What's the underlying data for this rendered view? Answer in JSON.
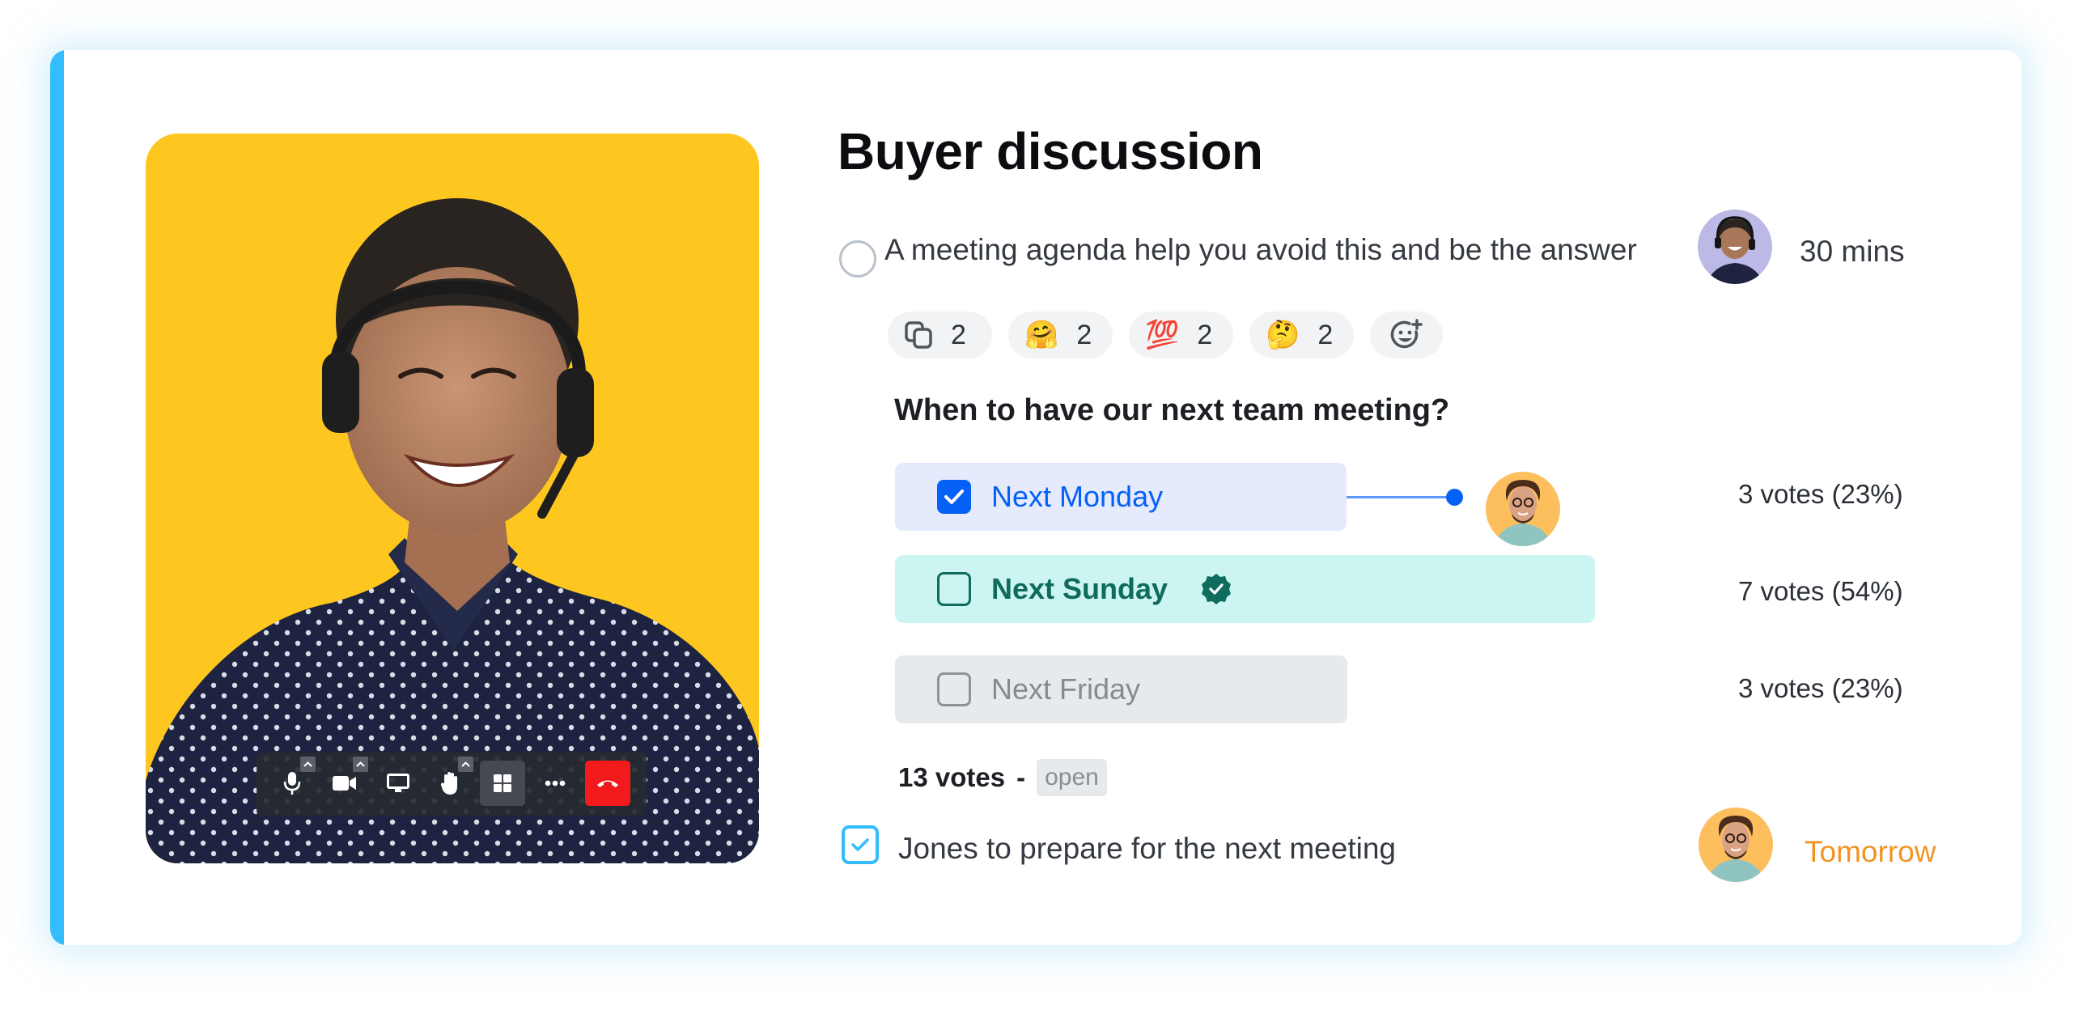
{
  "card": {
    "accent_color": "#34BDFD"
  },
  "video_call": {
    "background_color": "#FEC720",
    "toolbar": [
      {
        "name": "microphone",
        "icon": "mic-icon",
        "has_caret": true
      },
      {
        "name": "camera",
        "icon": "video-camera-icon",
        "has_caret": true
      },
      {
        "name": "share-screen",
        "icon": "monitor-icon",
        "has_caret": false
      },
      {
        "name": "raise-hand",
        "icon": "hand-icon",
        "has_caret": true
      },
      {
        "name": "layout-grid",
        "icon": "grid-icon",
        "has_caret": false,
        "active": true
      },
      {
        "name": "more",
        "icon": "more-dots-icon",
        "has_caret": false
      },
      {
        "name": "hang-up",
        "icon": "phone-hangup-icon",
        "has_caret": false,
        "color": "#F21A1A"
      }
    ]
  },
  "title": "Buyer discussion",
  "agenda_item": {
    "text": "A meeting agenda help you avoid this and be the answer",
    "duration": "30 mins",
    "checked": false,
    "avatar": "woman-with-headset-avatar"
  },
  "reactions": [
    {
      "icon": "copy-icon",
      "glyph": "",
      "count": "2"
    },
    {
      "icon": "hugging-face-emoji",
      "glyph": "🤗",
      "count": "2"
    },
    {
      "icon": "hundred-points-emoji",
      "glyph": "💯",
      "count": "2"
    },
    {
      "icon": "thinking-face-emoji",
      "glyph": "🤔",
      "count": "2"
    },
    {
      "icon": "add-emoji-icon",
      "glyph": "",
      "count": ""
    }
  ],
  "poll": {
    "question": "When to have our next team meeting?",
    "options": [
      {
        "label": "Next Monday",
        "votes": "3 votes (23%)",
        "vote_count": 3,
        "percent": 23,
        "selected": true,
        "color": "#0561F5"
      },
      {
        "label": "Next Sunday",
        "votes": "7 votes (54%)",
        "vote_count": 7,
        "percent": 54,
        "selected": false,
        "winner": true,
        "color": "#0E6B5E"
      },
      {
        "label": "Next Friday",
        "votes": "3 votes (23%)",
        "vote_count": 3,
        "percent": 23,
        "selected": false,
        "color": "#86898e"
      }
    ],
    "total": "13 votes",
    "separator": "-",
    "status": "open"
  },
  "task": {
    "text": "Jones to prepare for the next meeting",
    "checked": true,
    "due": "Tomorrow",
    "due_color": "#F29425",
    "avatar": "curly-hair-man-avatar"
  }
}
